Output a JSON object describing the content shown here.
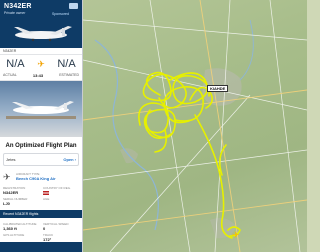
{
  "header": {
    "registration": "N342ER",
    "owner": "Private owner",
    "mini_label": "Sponsored"
  },
  "status_strip": {
    "left": "N342ER",
    "right": ""
  },
  "route": {
    "origin": "N/A",
    "destination": "N/A"
  },
  "times": {
    "left": "ACTUAL",
    "center": "13:43",
    "right": "ESTIMATED"
  },
  "ad": {
    "caption": "",
    "button": ""
  },
  "promo": {
    "title": "An Optimized Flight Plan"
  },
  "jets": {
    "label": "Jetes",
    "action": "Open ›"
  },
  "aircraft": {
    "type_label": "AIRCRAFT TYPE",
    "type_value": "",
    "registration_label": "REGISTRATION",
    "registration_value": "N342ER",
    "model_label": "",
    "model_value": "Beech C90A King Air",
    "country_label": "COUNTRY OF REG.",
    "serial_label": "SERIAL NUMBER",
    "serial_value": "LJ0",
    "age_label": "AGE",
    "age_value": ""
  },
  "recent": {
    "label": "Recent N342ER flights"
  },
  "stats": {
    "altitude_label": "CALIBRATED ALTITUDE",
    "altitude_value": "1,360 ft",
    "vs_label": "VERTICAL SPEED",
    "vs_value": "0",
    "gps_label": "GPS ALTITUDE",
    "track_label": "TRACK",
    "track_value": "172°"
  },
  "bottom_nav": [
    "",
    "",
    "",
    ""
  ],
  "map": {
    "airport_tag": "KIAHDE"
  },
  "colors": {
    "header": "#0e3b66",
    "track": "#e6f000",
    "accent": "#f2a200"
  }
}
